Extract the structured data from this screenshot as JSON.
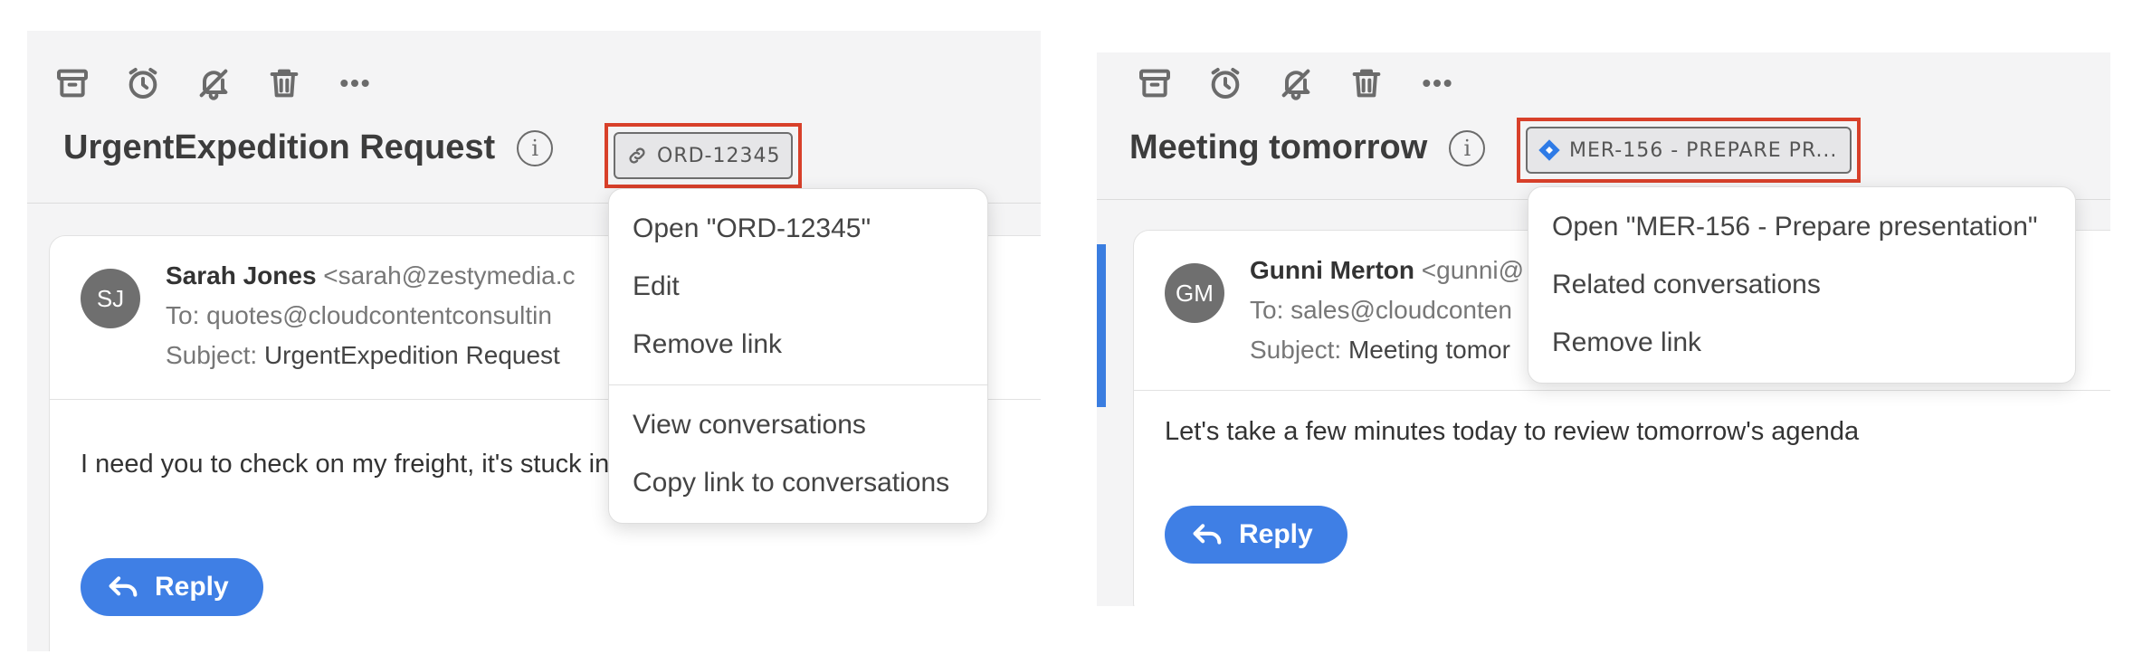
{
  "toolbar_icons": [
    "archive-icon",
    "snooze-clock-icon",
    "mute-bell-icon",
    "trash-icon",
    "more-icon"
  ],
  "left": {
    "title": "UrgentExpedition Request",
    "chip": {
      "label": "ORD-12345",
      "icon": "link-icon"
    },
    "message": {
      "avatar_initials": "SJ",
      "sender_name": "Sarah Jones",
      "sender_email": " <sarah@zestymedia.c",
      "to": "To: quotes@cloudcontentconsultin",
      "subject_label": "Subject: ",
      "subject_value": "UrgentExpedition Request",
      "body": "I need you to check on my freight, it's stuck in customs and I need it expedited"
    },
    "reply_label": "Reply",
    "menu": {
      "items": [
        "Open \"ORD-12345\"",
        "Edit",
        "Remove link"
      ],
      "items_after_divider": [
        "View conversations",
        "Copy link to conversations"
      ]
    }
  },
  "right": {
    "title": "Meeting tomorrow",
    "chip": {
      "label": "MER-156 - PREPARE PR...",
      "icon": "jira-diamond-icon",
      "icon_color": "#2f7be6"
    },
    "message": {
      "avatar_initials": "GM",
      "sender_name": "Gunni Merton",
      "sender_email": " <gunni@",
      "to": "To: sales@cloudconten",
      "subject_label": "Subject: ",
      "subject_value": "Meeting tomor",
      "body": "Let's take a few minutes today to review tomorrow's agenda"
    },
    "reply_label": "Reply",
    "menu": {
      "items": [
        "Open \"MER-156 - Prepare presentation\"",
        "Related conversations",
        "Remove link"
      ]
    }
  },
  "colors": {
    "accent_blue": "#3f7fe5",
    "highlight_red": "#d8402a"
  }
}
